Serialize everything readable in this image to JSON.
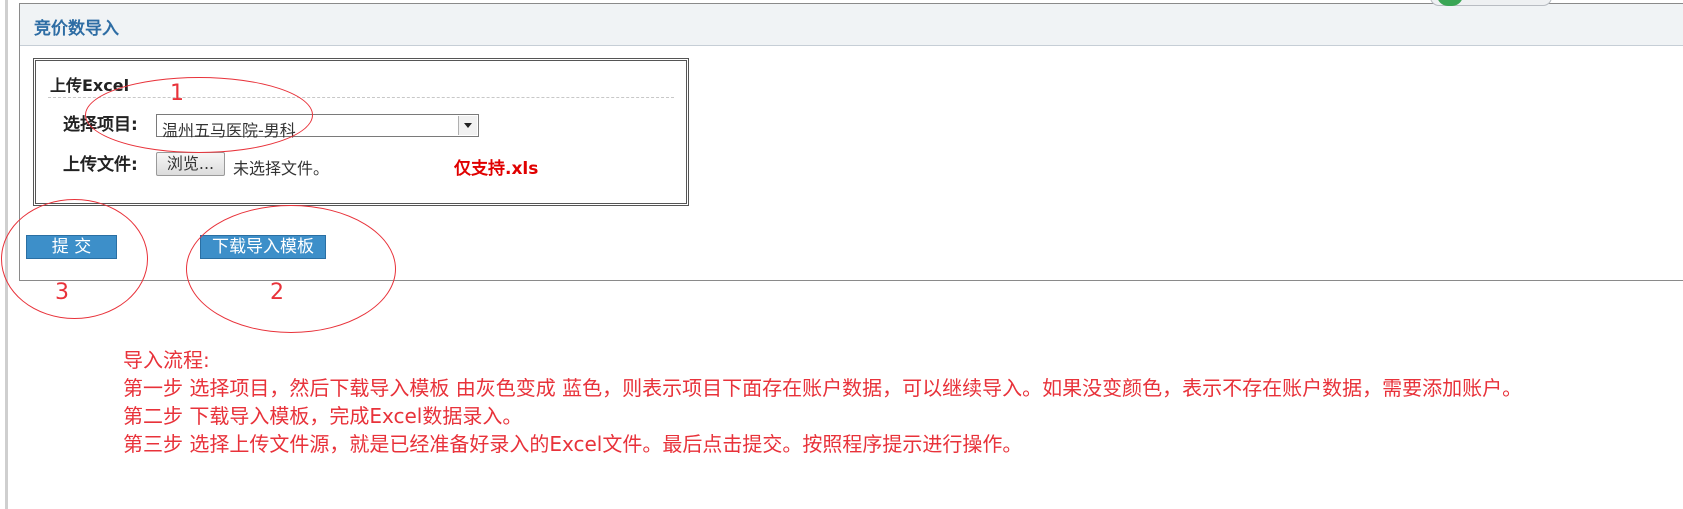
{
  "panel": {
    "title": "竞价数导入"
  },
  "upload": {
    "legend": "上传Excel",
    "project_label": "选择项目:",
    "project_selected": "温州五马医院-男科",
    "file_label": "上传文件:",
    "browse_label": "浏览...",
    "file_status": "未选择文件。",
    "format_note": "仅支持.xls"
  },
  "actions": {
    "submit_label": "提 交",
    "download_label": "下载导入模板"
  },
  "annotations": {
    "mark_1": "1",
    "mark_2": "2",
    "mark_3": "3"
  },
  "instructions": {
    "heading": "导入流程:",
    "step1": "第一步 选择项目，然后下载导入模板 由灰色变成 蓝色，则表示项目下面存在账户数据，可以继续导入。如果没变颜色，表示不存在账户数据，需要添加账户。",
    "step2": "第二步 下载导入模板，完成Excel数据录入。",
    "step3": "第三步 选择上传文件源，就是已经准备好录入的Excel文件。最后点击提交。按照程序提示进行操作。"
  },
  "colors": {
    "title": "#2e6da4",
    "button": "#3d8fc9",
    "annotation": "#e8323a",
    "note": "#e00000"
  }
}
